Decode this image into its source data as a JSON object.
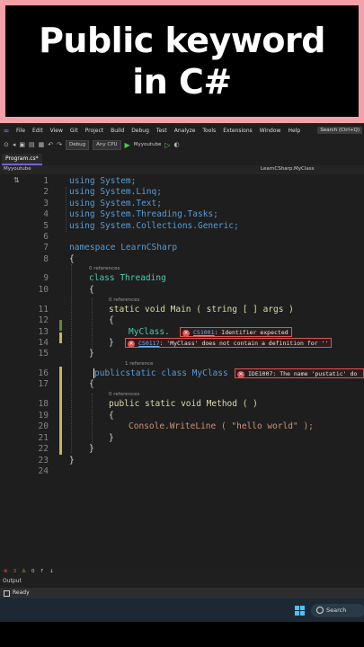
{
  "banner": {
    "line1": "Public keyword",
    "line2": "in C#"
  },
  "menu": {
    "items": [
      "File",
      "Edit",
      "View",
      "Git",
      "Project",
      "Build",
      "Debug",
      "Test",
      "Analyze",
      "Tools",
      "Extensions",
      "Window",
      "Help"
    ],
    "search": "Search (Ctrl+Q)"
  },
  "toolbar": {
    "config": "Debug",
    "platform": "Any CPU",
    "run_target": "Myyoutube"
  },
  "tab": {
    "name": "Program.cs*"
  },
  "nav": {
    "left": "Myyoutube",
    "right": "LearnCSharp.MyClass"
  },
  "code": {
    "lines": [
      "using System;",
      "using System.Linq;",
      "using System.Text;",
      "using System.Threading.Tasks;",
      "using System.Collections.Generic;",
      "",
      "namespace LearnCSharp",
      "{",
      "class Threading",
      "{",
      "static void Main ( string [ ] args )",
      "{",
      "MyClass.",
      "}",
      "}",
      "publicstatic class MyClass",
      "{",
      "public static void Method ( )",
      "{",
      "Console.WriteLine ( \"hello world\" );",
      "}",
      "}",
      "}",
      ""
    ],
    "line_numbers": [
      "1",
      "2",
      "3",
      "4",
      "5",
      "6",
      "7",
      "8",
      "9",
      "10",
      "11",
      "12",
      "13",
      "14",
      "15",
      "16",
      "17",
      "18",
      "19",
      "20",
      "21",
      "22",
      "23",
      "24"
    ],
    "ref_threading": "0 references",
    "ref_main": "0 references",
    "ref_myclass": "1 reference",
    "ref_method": "0 references"
  },
  "errors": [
    {
      "code": "CS1001",
      "message": ": Identifier expected"
    },
    {
      "code": "CS0117",
      "message": ": 'MyClass' does not contain a definition for ''"
    },
    {
      "code": "IDE1007",
      "message": ": The name 'pustatic' do"
    }
  ],
  "status": {
    "error_count": "3",
    "warning_count": "0",
    "output_label": "Output",
    "ready": "Ready"
  },
  "taskbar": {
    "search": "Search"
  },
  "colors": {
    "banner_bg": "#000000",
    "frame": "#f4a0a8",
    "keyword": "#569cd6",
    "type": "#4ec9b0",
    "method": "#dcdcaa",
    "string": "#ce9178",
    "error": "#e05252"
  }
}
